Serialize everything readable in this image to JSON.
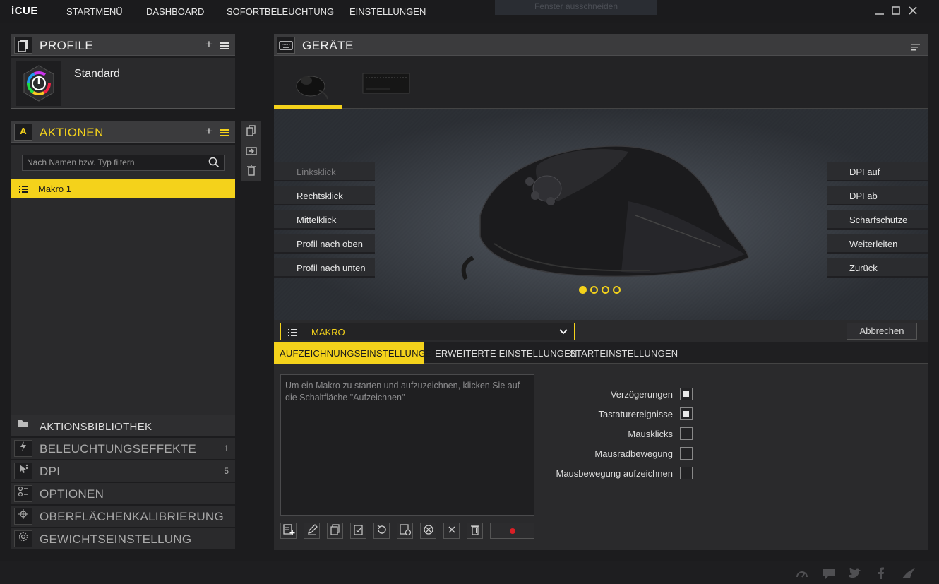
{
  "app": {
    "logo": "iCUE",
    "nav": [
      "STARTMENÜ",
      "DASHBOARD",
      "SOFORTBELEUCHTUNG",
      "EINSTELLUNGEN"
    ],
    "snip_label": "Fenster ausschneiden"
  },
  "profile": {
    "title": "PROFILE",
    "name": "Standard"
  },
  "actions": {
    "title": "AKTIONEN",
    "search_placeholder": "Nach Namen bzw. Typ filtern",
    "items": [
      {
        "label": "Makro 1"
      }
    ]
  },
  "library": [
    {
      "label": "AKTIONSBIBLIOTHEK",
      "count": ""
    },
    {
      "label": "BELEUCHTUNGSEFFEKTE",
      "count": "1"
    },
    {
      "label": "DPI",
      "count": "5"
    },
    {
      "label": "OPTIONEN",
      "count": ""
    },
    {
      "label": "OBERFLÄCHENKALIBRIERUNG",
      "count": ""
    },
    {
      "label": "GEWICHTSEINSTELLUNG",
      "count": ""
    }
  ],
  "devices": {
    "title": "GERÄTE"
  },
  "mouse_buttons": {
    "left": [
      "Linksklick",
      "Rechtsklick",
      "Mittelklick",
      "Profil nach oben",
      "Profil nach unten"
    ],
    "right": [
      "DPI auf",
      "DPI ab",
      "Scharfschütze",
      "Weiterleiten",
      "Zurück"
    ]
  },
  "pager": {
    "pages": 4,
    "active": 1
  },
  "macro": {
    "type_label": "MAKRO",
    "cancel_label": "Abbrechen",
    "tabs": [
      "AUFZEICHNUNGSEINSTELLUNGEN",
      "ERWEITERTE EINSTELLUNGEN",
      "STARTEINSTELLUNGEN"
    ],
    "hint": "Um ein Makro zu starten und aufzuzeichnen, klicken Sie auf die Schaltfläche \"Aufzeichnen\"",
    "options": [
      {
        "label": "Verzögerungen",
        "checked": true
      },
      {
        "label": "Tastaturereignisse",
        "checked": true
      },
      {
        "label": "Mausklicks",
        "checked": false
      },
      {
        "label": "Mausradbewegung",
        "checked": false
      },
      {
        "label": "Mausbewegung aufzeichnen",
        "checked": false
      }
    ]
  },
  "colors": {
    "accent": "#f4d21b",
    "record": "#d91f26"
  }
}
